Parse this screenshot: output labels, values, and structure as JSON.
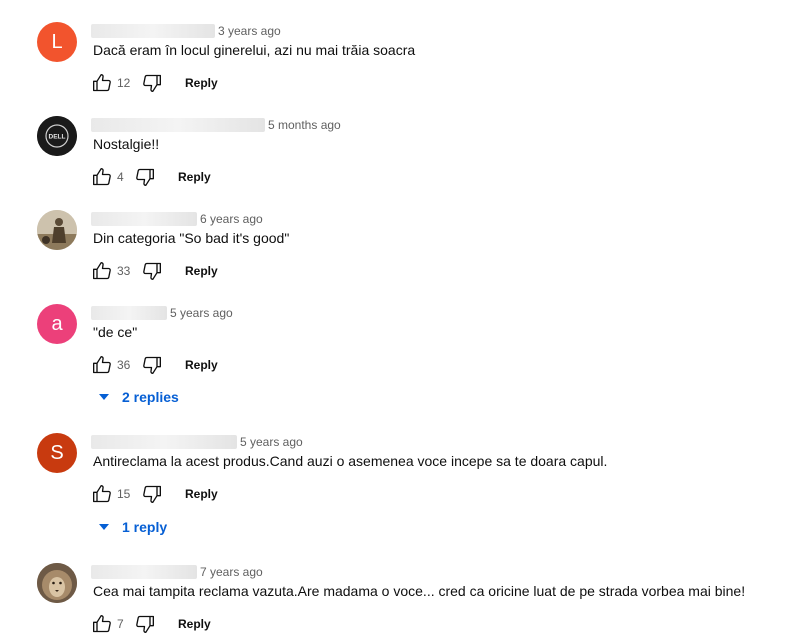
{
  "ui": {
    "reply_label": "Reply",
    "colors": {
      "link": "#065fd4",
      "secondary_text": "#606060",
      "primary_text": "#0f0f0f"
    }
  },
  "comments": [
    {
      "avatar": {
        "type": "letter",
        "letter": "L",
        "color": "#f2542d"
      },
      "time": "3 years ago",
      "text": "Dacă eram în locul ginerelui, azi nu mai trăia soacra",
      "likes": "12"
    },
    {
      "avatar": {
        "type": "image",
        "icon": "dell-logo-icon",
        "color": "#1a1a1a"
      },
      "time": "5 months ago",
      "text": "Nostalgie!!",
      "likes": "4"
    },
    {
      "avatar": {
        "type": "image",
        "icon": "person-photo-icon",
        "color": "#b3a48a"
      },
      "time": "6 years ago",
      "text": "Din categoria \"So bad it's good\"",
      "likes": "33"
    },
    {
      "avatar": {
        "type": "letter",
        "letter": "a",
        "color": "#ec407a"
      },
      "time": "5 years ago",
      "text": "\"de ce\"",
      "likes": "36",
      "replies_label": "2 replies"
    },
    {
      "avatar": {
        "type": "letter",
        "letter": "S",
        "color": "#c83a0f"
      },
      "time": "5 years ago",
      "text": "Antireclama la acest produs.Cand auzi o asemenea voce incepe sa te doara capul.",
      "likes": "15",
      "replies_label": "1 reply"
    },
    {
      "avatar": {
        "type": "image",
        "icon": "lion-photo-icon",
        "color": "#8a7058"
      },
      "time": "7 years ago",
      "text": "Cea mai tampita reclama vazuta.Are madama o voce... cred ca oricine luat de pe strada vorbea mai bine!",
      "likes": "7"
    }
  ]
}
